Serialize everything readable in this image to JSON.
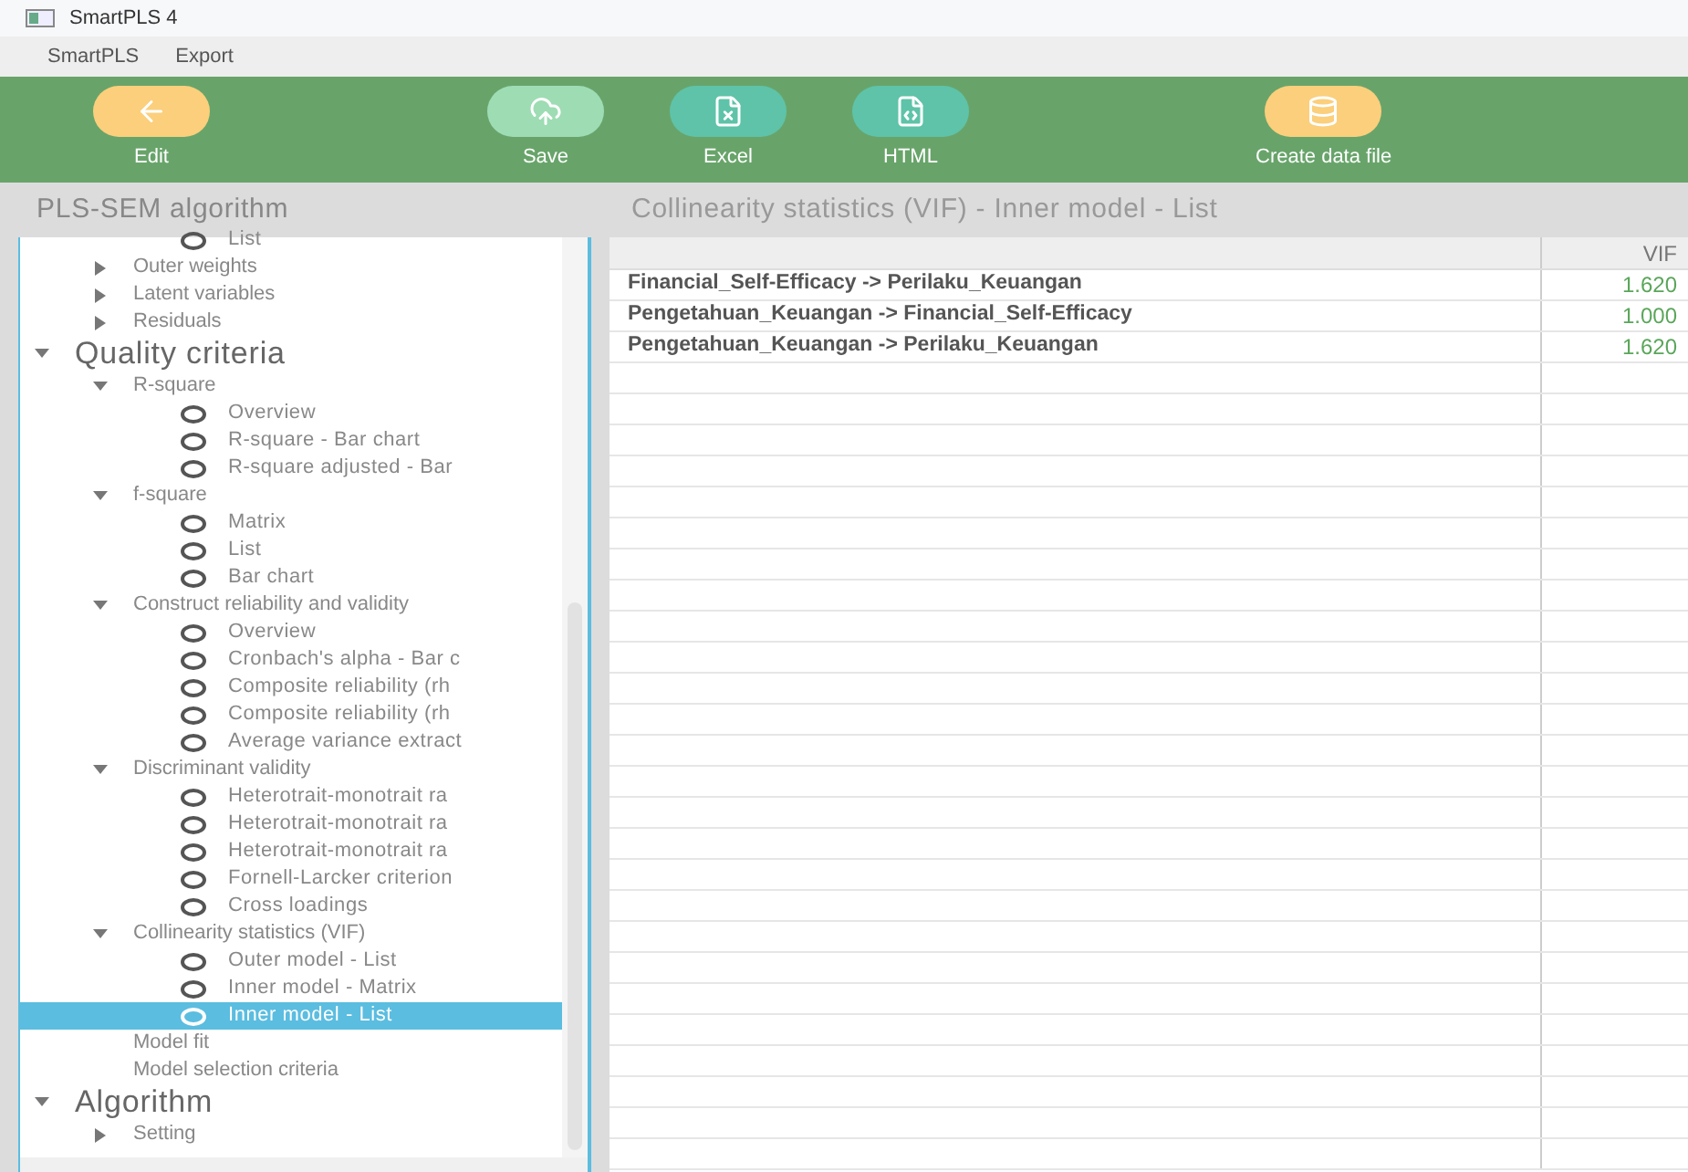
{
  "window": {
    "title": "SmartPLS 4"
  },
  "menu": [
    "SmartPLS",
    "Export"
  ],
  "toolbar": [
    {
      "label": "Edit",
      "kind": "back",
      "color": "#fbcf7c"
    },
    {
      "label": "Save",
      "kind": "cloud",
      "color": "#9edcb4"
    },
    {
      "label": "Excel",
      "kind": "excel",
      "color": "#5ec3a8"
    },
    {
      "label": "HTML",
      "kind": "html",
      "color": "#5ec3a8"
    },
    {
      "label": "Create data file",
      "kind": "database",
      "color": "#fbcf7c"
    }
  ],
  "sidebar": {
    "title": "PLS-SEM algorithm",
    "items": [
      {
        "kind": "leaf",
        "label": "List",
        "selected": false
      },
      {
        "kind": "group",
        "label": "Outer weights",
        "expanded": false
      },
      {
        "kind": "group",
        "label": "Latent variables",
        "expanded": false
      },
      {
        "kind": "group",
        "label": "Residuals",
        "expanded": false
      },
      {
        "kind": "section",
        "label": "Quality criteria",
        "expanded": true,
        "children": [
          {
            "kind": "group",
            "label": "R-square",
            "expanded": true,
            "children": [
              {
                "kind": "leaf",
                "label": "Overview",
                "selected": false
              },
              {
                "kind": "leaf",
                "label": "R-square - Bar chart",
                "selected": false
              },
              {
                "kind": "leaf",
                "label": "R-square adjusted - Bar",
                "selected": false
              }
            ]
          },
          {
            "kind": "group",
            "label": "f-square",
            "expanded": true,
            "children": [
              {
                "kind": "leaf",
                "label": "Matrix",
                "selected": false
              },
              {
                "kind": "leaf",
                "label": "List",
                "selected": false
              },
              {
                "kind": "leaf",
                "label": "Bar chart",
                "selected": false
              }
            ]
          },
          {
            "kind": "group",
            "label": "Construct reliability and validity",
            "expanded": true,
            "children": [
              {
                "kind": "leaf",
                "label": "Overview",
                "selected": false
              },
              {
                "kind": "leaf",
                "label": "Cronbach's alpha - Bar c",
                "selected": false
              },
              {
                "kind": "leaf",
                "label": "Composite reliability (rh",
                "selected": false
              },
              {
                "kind": "leaf",
                "label": "Composite reliability (rh",
                "selected": false
              },
              {
                "kind": "leaf",
                "label": "Average variance extract",
                "selected": false
              }
            ]
          },
          {
            "kind": "group",
            "label": "Discriminant validity",
            "expanded": true,
            "children": [
              {
                "kind": "leaf",
                "label": "Heterotrait-monotrait ra",
                "selected": false
              },
              {
                "kind": "leaf",
                "label": "Heterotrait-monotrait ra",
                "selected": false
              },
              {
                "kind": "leaf",
                "label": "Heterotrait-monotrait ra",
                "selected": false
              },
              {
                "kind": "leaf",
                "label": "Fornell-Larcker criterion",
                "selected": false
              },
              {
                "kind": "leaf",
                "label": "Cross loadings",
                "selected": false
              }
            ]
          },
          {
            "kind": "group",
            "label": "Collinearity statistics (VIF)",
            "expanded": true,
            "children": [
              {
                "kind": "leaf",
                "label": "Outer model - List",
                "selected": false
              },
              {
                "kind": "leaf",
                "label": "Inner model - Matrix",
                "selected": false
              },
              {
                "kind": "leaf",
                "label": "Inner model - List",
                "selected": true
              }
            ]
          },
          {
            "kind": "item",
            "label": "Model fit"
          },
          {
            "kind": "item",
            "label": "Model selection criteria"
          }
        ]
      },
      {
        "kind": "section",
        "label": "Algorithm",
        "expanded": true,
        "children": [
          {
            "kind": "group",
            "label": "Setting",
            "expanded": false
          }
        ]
      }
    ]
  },
  "content": {
    "title": "Collinearity statistics (VIF) - Inner model - List",
    "table": {
      "columns": [
        "VIF"
      ],
      "rows": [
        {
          "path": "Financial_Self-Efficacy -> Perilaku_Keuangan",
          "vif": "1.620"
        },
        {
          "path": "Pengetahuan_Keuangan -> Financial_Self-Efficacy",
          "vif": "1.000"
        },
        {
          "path": "Pengetahuan_Keuangan -> Perilaku_Keuangan",
          "vif": "1.620"
        }
      ]
    }
  }
}
